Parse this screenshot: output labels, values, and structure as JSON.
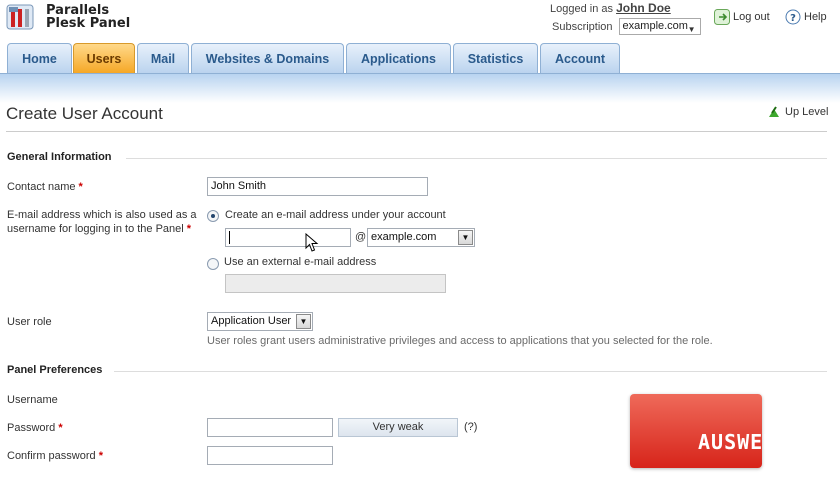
{
  "brand": {
    "line1": "Parallels",
    "line2": "Plesk Panel"
  },
  "session": {
    "logged_in_prefix": "Logged in as",
    "user_name": "John Doe",
    "subscription_label": "Subscription",
    "subscription_value": "example.com"
  },
  "top_links": {
    "logout": "Log out",
    "help": "Help"
  },
  "tabs": [
    {
      "label": "Home"
    },
    {
      "label": "Users"
    },
    {
      "label": "Mail"
    },
    {
      "label": "Websites & Domains"
    },
    {
      "label": "Applications"
    },
    {
      "label": "Statistics"
    },
    {
      "label": "Account"
    }
  ],
  "active_tab": "Users",
  "page": {
    "title": "Create User Account",
    "up_level": "Up Level"
  },
  "general": {
    "heading": "General Information",
    "contact_name_label": "Contact name",
    "contact_name_value": "John Smith",
    "email_label": "E-mail address which is also used as a username for logging in to the Panel",
    "radio_internal": "Create an e-mail address under your account",
    "email_local_value": "",
    "at_sign": "@",
    "email_domain": "example.com",
    "radio_external": "Use an external e-mail address",
    "external_email_value": "",
    "role_label": "User role",
    "role_value": "Application User",
    "role_hint": "User roles grant users administrative privileges and access to applications that you selected for the role."
  },
  "prefs": {
    "heading": "Panel Preferences",
    "username_label": "Username",
    "password_label": "Password",
    "password_strength": "Very weak",
    "password_help": "(?)",
    "confirm_label": "Confirm password"
  },
  "required_mark": "*",
  "watermark": "AUSWEB",
  "colors": {
    "active_tab": "#f5a623",
    "tab": "#b9d2ee",
    "link": "#2a5a8c",
    "required": "#cc0000",
    "watermark": "#d7241a"
  }
}
